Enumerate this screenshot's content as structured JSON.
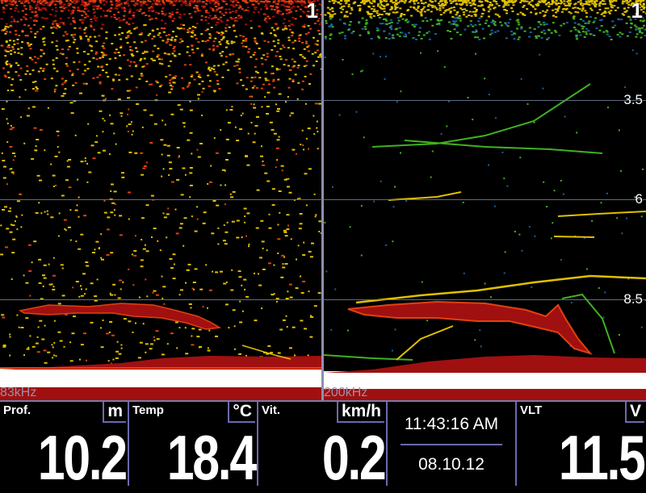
{
  "sonar": {
    "left": {
      "frequency": "83kHz",
      "range_top": "1"
    },
    "right": {
      "frequency": "200kHz",
      "range_top": "1"
    },
    "depth_marks": [
      "3.5",
      "6",
      "8.5"
    ],
    "colors": {
      "strong": "#a01010",
      "medium": "#e04010",
      "weak": "#e0c000",
      "faint": "#40b020",
      "bottom": "#ffffff"
    }
  },
  "footer": {
    "depth": {
      "label": "Prof.",
      "unit": "m",
      "value": "10.2"
    },
    "temp": {
      "label": "Temp",
      "unit": "°C",
      "value": "18.4"
    },
    "speed": {
      "label": "Vit.",
      "unit": "km/h",
      "value": "0.2"
    },
    "clock": {
      "time": "11:43:16 AM",
      "date": "08.10.12"
    },
    "voltage": {
      "label": "VLT",
      "unit": "V",
      "value": "11.5"
    }
  }
}
